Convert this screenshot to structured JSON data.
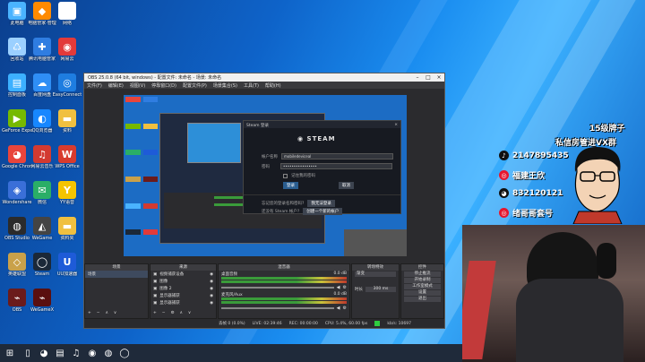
{
  "desktop": {
    "icons": [
      {
        "label": "此电脑",
        "color": "#4ab3ff",
        "glyph": "▣"
      },
      {
        "label": "电脑管家·管理",
        "color": "#ff8a00",
        "glyph": "◆"
      },
      {
        "label": "网络",
        "color": "#ffffff",
        "glyph": "⬚"
      },
      {
        "label": "回收站",
        "color": "#9bd0ff",
        "glyph": "♺"
      },
      {
        "label": "腾讯电脑管家",
        "color": "#2f7de1",
        "glyph": "✚"
      },
      {
        "label": "网易云",
        "color": "#e23a3a",
        "glyph": "◉"
      },
      {
        "label": "控制面板",
        "color": "#3cb0ff",
        "glyph": "▤"
      },
      {
        "label": "百度网盘",
        "color": "#2f8ef5",
        "glyph": "☁"
      },
      {
        "label": "EasyConnect",
        "color": "#1e7de0",
        "glyph": "◎"
      },
      {
        "label": "GeForce Experience",
        "color": "#76b900",
        "glyph": "▶"
      },
      {
        "label": "QQ浏览器",
        "color": "#1787ff",
        "glyph": "◐"
      },
      {
        "label": "资料",
        "color": "#f0c040",
        "glyph": "▬"
      },
      {
        "label": "Google Chrome",
        "color": "#e8453c",
        "glyph": "◕"
      },
      {
        "label": "网易云音乐",
        "color": "#d33a31",
        "glyph": "♫"
      },
      {
        "label": "WPS Office",
        "color": "#d83b2e",
        "glyph": "W"
      },
      {
        "label": "Wondershare",
        "color": "#3a6fd8",
        "glyph": "◈"
      },
      {
        "label": "微信",
        "color": "#2aae67",
        "glyph": "✉"
      },
      {
        "label": "YY语音",
        "color": "#f5c400",
        "glyph": "Y"
      },
      {
        "label": "OBS Studio",
        "color": "#2b2b2b",
        "glyph": "◍"
      },
      {
        "label": "WeGame",
        "color": "#444444",
        "glyph": "◭"
      },
      {
        "label": "资料夹",
        "color": "#f0c040",
        "glyph": "▬"
      },
      {
        "label": "英雄联盟",
        "color": "#c9a14a",
        "glyph": "◇"
      },
      {
        "label": "Steam",
        "color": "#1b2838",
        "glyph": "◯"
      },
      {
        "label": "UU加速器",
        "color": "#1e5bd8",
        "glyph": "U"
      },
      {
        "label": "OBS",
        "color": "#6b1b1b",
        "glyph": "⌁"
      },
      {
        "label": "WeGameX",
        "color": "#5a0f0f",
        "glyph": "⌁"
      }
    ]
  },
  "obs": {
    "title": "OBS 25.0.8 (64 bit, windows) - 配置文件: 未命名 - 场景: 未命名",
    "menu": [
      "文件(F)",
      "编辑(E)",
      "视图(V)",
      "停靠窗口(D)",
      "配置文件(P)",
      "场景集合(S)",
      "工具(T)",
      "帮助(H)"
    ],
    "docks": {
      "scenes": {
        "title": "场景",
        "items": [
          "场景"
        ]
      },
      "sources": {
        "title": "来源",
        "items": [
          "视频捕获设备",
          "图像",
          "图像 2",
          "显示器捕获",
          "显示器捕获"
        ]
      },
      "mixer": {
        "title": "混音器",
        "tracks": [
          {
            "name": "桌面音频",
            "level": "0.0 dB"
          },
          {
            "name": "麦克风/Aux",
            "level": "0.0 dB"
          }
        ]
      },
      "transitions": {
        "title": "转场特效",
        "type": "渐变",
        "duration_label": "时长",
        "duration": "300 ms"
      },
      "controls": {
        "title": "控件",
        "buttons": [
          "停止推流",
          "开始录制",
          "工作室模式",
          "设置",
          "退出"
        ]
      }
    },
    "status": {
      "dropped": "丢帧 0 (0.0%)",
      "live": "LIVE: 02:39:46",
      "rec": "REC: 00:00:00",
      "cpu": "CPU: 5.4%, 60.00 fps",
      "kbps": "kb/s: 10697"
    }
  },
  "steam_dialog": {
    "title": "Steam 登录",
    "brand": "STEAM",
    "account_label": "帐户名称",
    "account_value": "mobiledeviceal",
    "password_label": "密码",
    "password_value": "••••••••••••••••",
    "remember_label": "记住我的密码",
    "login_button": "登录",
    "cancel_button": "取消",
    "forgot_label": "忘记您的登录名和密码?",
    "forgot_button": "我无法登录",
    "new_label": "还没有 Steam 帐户?",
    "create_button": "创建一个新的帐户"
  },
  "overlay": {
    "title": "15级牌子",
    "subtitle": "私信房管进VX群",
    "socials": [
      {
        "platform": "douyin",
        "color": "#111111",
        "glyph": "♪",
        "text": "2147895435"
      },
      {
        "platform": "weibo",
        "color": "#e6162d",
        "glyph": "◎",
        "text": "福建王欣"
      },
      {
        "platform": "qq",
        "color": "#111111",
        "glyph": "◕",
        "text": "832120121"
      },
      {
        "platform": "toutiao",
        "color": "#e6162d",
        "glyph": "◎",
        "text": "绪哥哥套号"
      }
    ]
  },
  "taskbar": {
    "items": [
      {
        "name": "start",
        "glyph": "⊞"
      },
      {
        "name": "task-view",
        "glyph": "▯"
      },
      {
        "name": "chrome",
        "glyph": "◕"
      },
      {
        "name": "file-explorer",
        "glyph": "▤"
      },
      {
        "name": "netease-music",
        "glyph": "♫"
      },
      {
        "name": "netease-cloud",
        "glyph": "◉"
      },
      {
        "name": "obs",
        "glyph": "◍"
      },
      {
        "name": "steam",
        "glyph": "◯"
      }
    ]
  }
}
